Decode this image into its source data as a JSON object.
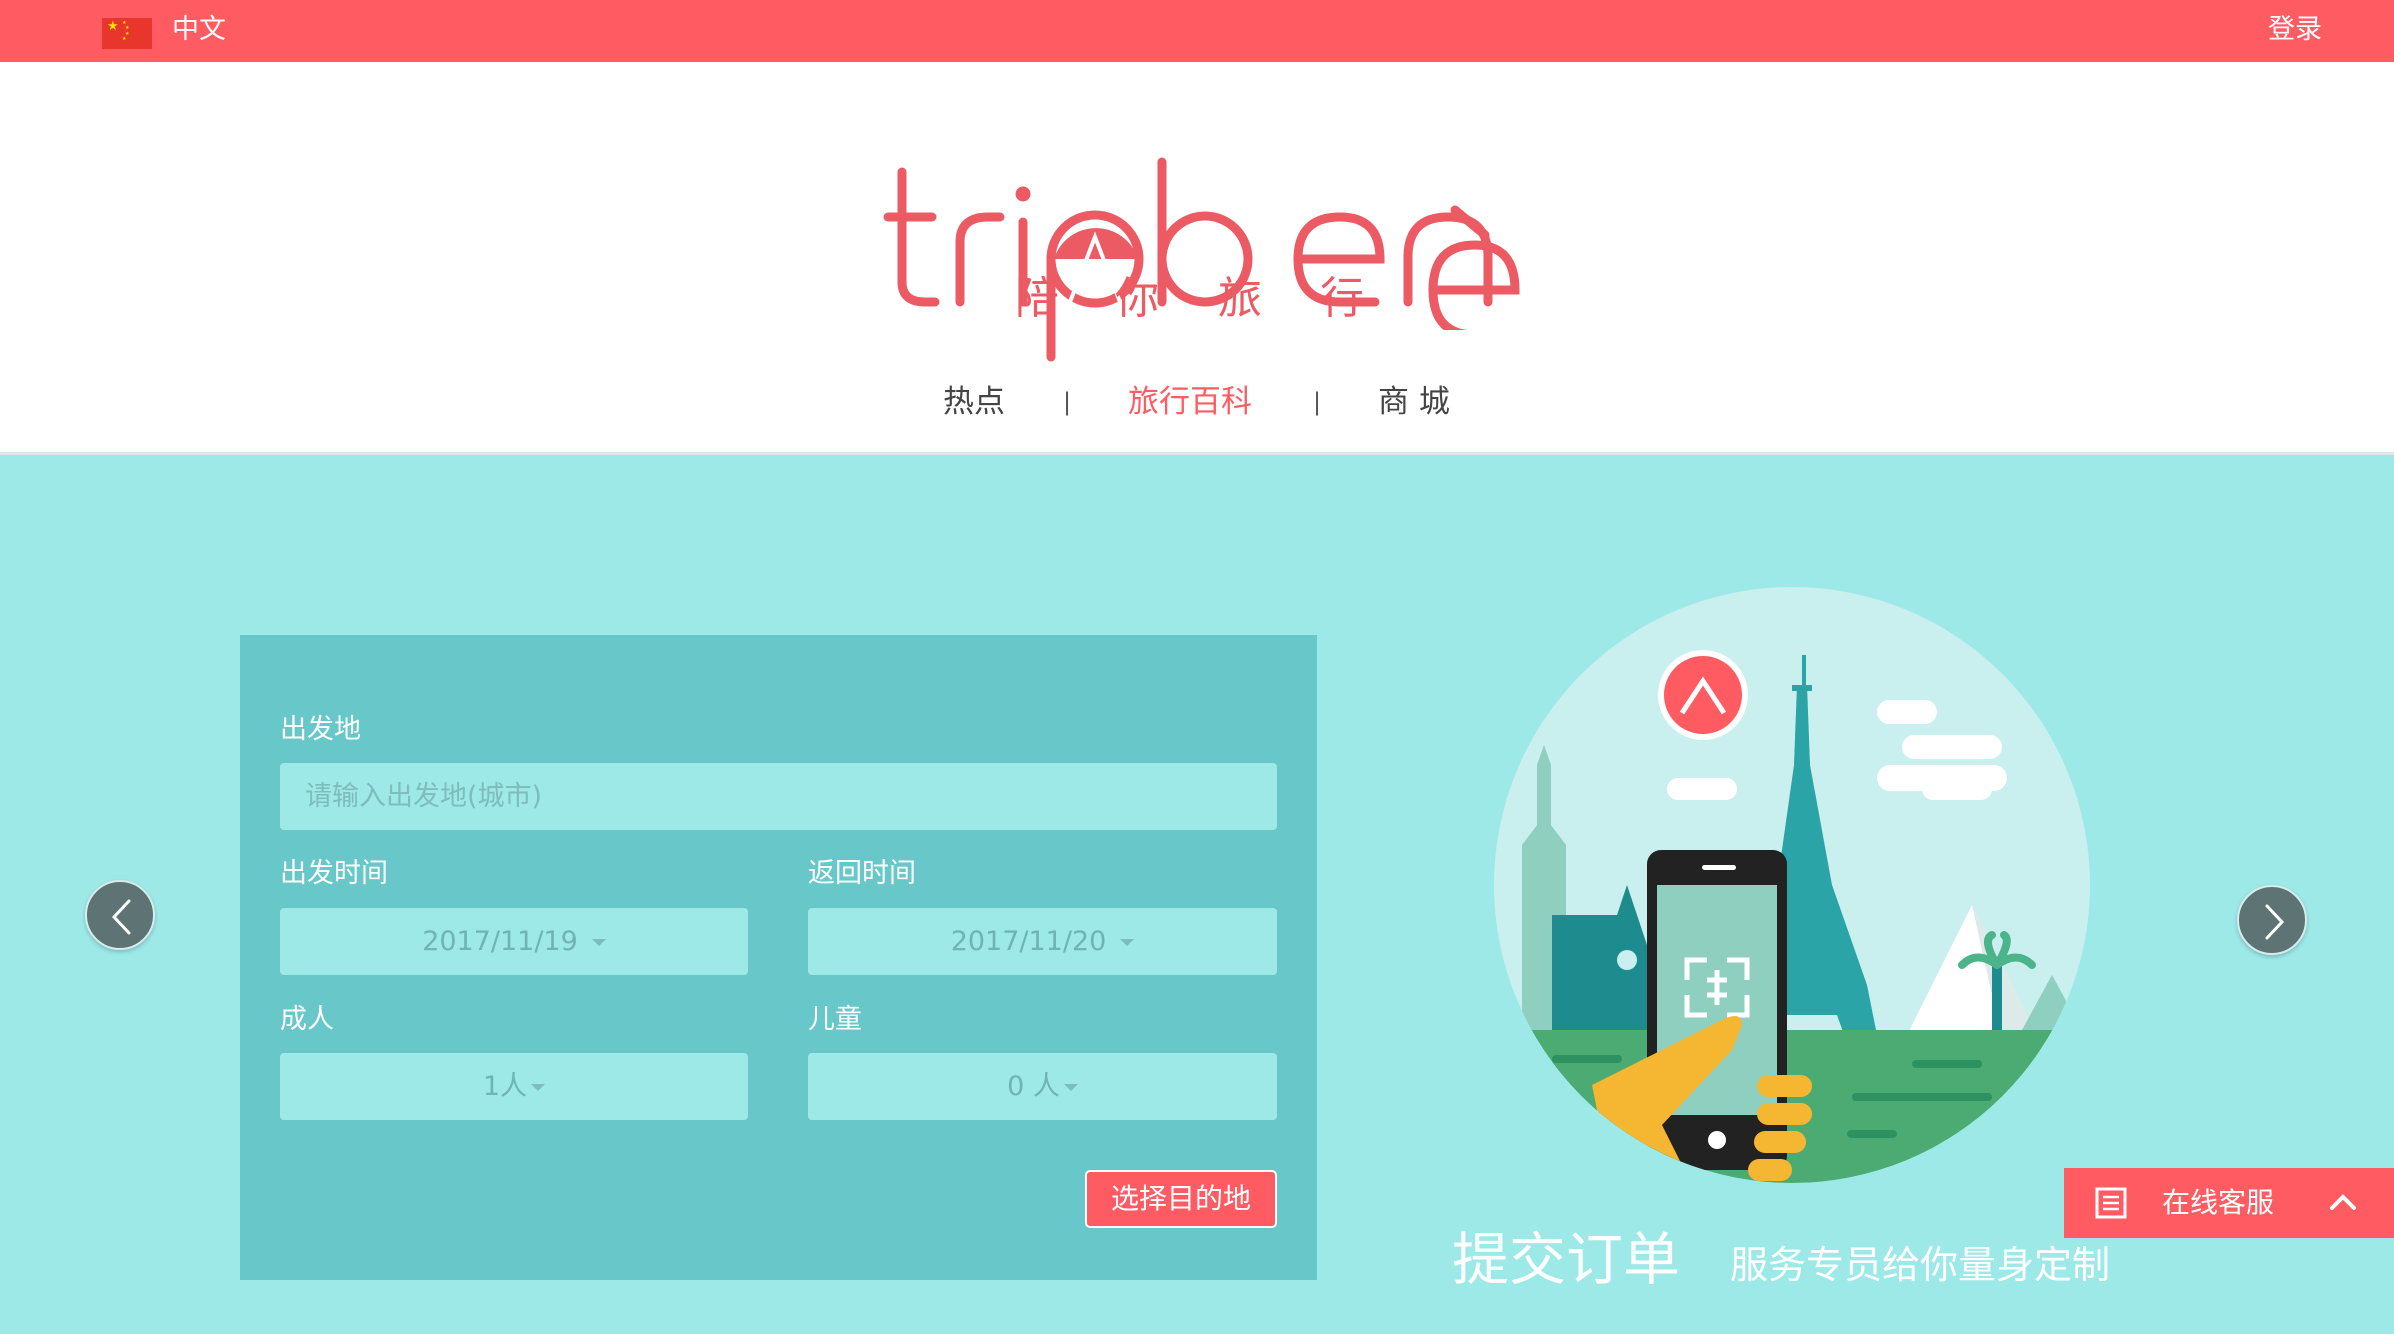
{
  "topbar": {
    "language": "中文",
    "flag_icon": "china-flag-icon",
    "login": "登录"
  },
  "header": {
    "brand": "trip benè",
    "tagline": [
      "陪",
      "你",
      "旅",
      "行"
    ],
    "nav": {
      "items": [
        {
          "label": "热点",
          "active": false
        },
        {
          "label": "旅行百科",
          "active": true
        },
        {
          "label": "商 城",
          "active": false
        }
      ],
      "separator": "|"
    }
  },
  "form": {
    "departure": {
      "label": "出发地",
      "placeholder": "请输入出发地(城市)"
    },
    "depart_date": {
      "label": "出发时间",
      "value": "2017/11/19"
    },
    "return_date": {
      "label": "返回时间",
      "value": "2017/11/20"
    },
    "adults": {
      "label": "成人",
      "value": "1人"
    },
    "children": {
      "label": "儿童",
      "value": "0 人"
    },
    "submit": "选择目的地"
  },
  "carousel": {
    "prev_icon": "chevron-left-icon",
    "next_icon": "chevron-right-icon"
  },
  "slogan": {
    "main": "提交订单",
    "sub": "服务专员给你量身定制"
  },
  "service": {
    "label": "在线客服",
    "icon": "list-icon",
    "toggle_icon": "chevron-up-icon"
  },
  "colors": {
    "brand": "#ff5b63",
    "hero_bg": "#9de9e8",
    "panel_bg": "#68c8c9",
    "input_bg": "#9de9e8",
    "nav_active": "#ff5b63"
  }
}
